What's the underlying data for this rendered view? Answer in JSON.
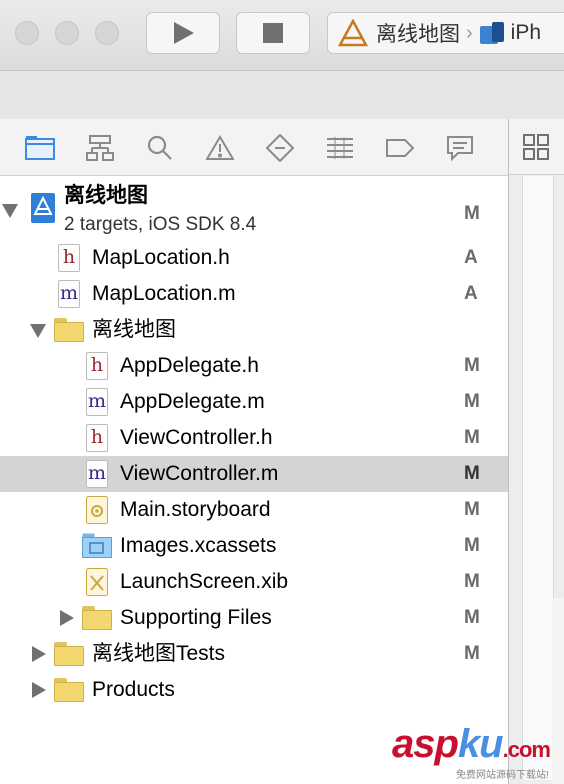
{
  "toolbar": {
    "scheme_project": "离线地图",
    "scheme_device": "iPh"
  },
  "navigator": {
    "icons": [
      "folder-icon",
      "hierarchy-icon",
      "search-icon",
      "warning-icon",
      "diamond-icon",
      "list-icon",
      "tag-icon",
      "speech-bubble-icon"
    ]
  },
  "project": {
    "name": "离线地图",
    "subtitle": "2 targets, iOS SDK 8.4",
    "status": "M"
  },
  "files": [
    {
      "label": "MapLocation.h",
      "status": "A",
      "type": "h"
    },
    {
      "label": "MapLocation.m",
      "status": "A",
      "type": "m"
    },
    {
      "label": "离线地图",
      "status": "",
      "type": "folder"
    },
    {
      "label": "AppDelegate.h",
      "status": "M",
      "type": "h"
    },
    {
      "label": "AppDelegate.m",
      "status": "M",
      "type": "m"
    },
    {
      "label": "ViewController.h",
      "status": "M",
      "type": "h"
    },
    {
      "label": "ViewController.m",
      "status": "M",
      "type": "m"
    },
    {
      "label": "Main.storyboard",
      "status": "M",
      "type": "storyboard"
    },
    {
      "label": "Images.xcassets",
      "status": "M",
      "type": "xcassets"
    },
    {
      "label": "LaunchScreen.xib",
      "status": "M",
      "type": "xib"
    },
    {
      "label": "Supporting Files",
      "status": "M",
      "type": "folder"
    },
    {
      "label": "离线地图Tests",
      "status": "M",
      "type": "folder"
    },
    {
      "label": "Products",
      "status": "",
      "type": "folder"
    }
  ],
  "watermark": {
    "asp": "asp",
    "ku": "ku",
    "com": ".com",
    "sub": "免费网站源码下载站!"
  }
}
